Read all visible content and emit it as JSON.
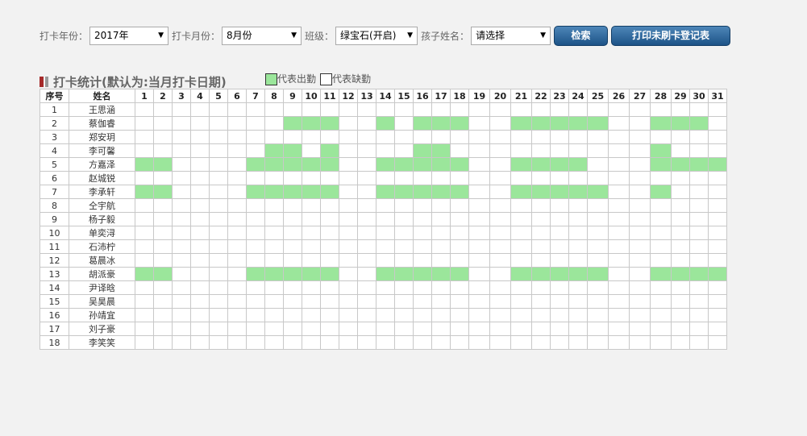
{
  "filters": {
    "year_label": "打卡年份：",
    "year_value": "2017年",
    "month_label": "打卡月份：",
    "month_value": "8月份",
    "class_label": "班级：",
    "class_value": "绿宝石(开启)",
    "child_label": "孩子姓名：",
    "child_value": "请选择",
    "search_button": "检索",
    "print_button": "打印未刷卡登记表"
  },
  "section": {
    "title": "打卡统计(默认为:当月打卡日期)"
  },
  "legend": {
    "present_label": "代表出勤",
    "absent_label": "代表缺勤",
    "present_color": "#9be69b",
    "absent_color": "#ffffff"
  },
  "table": {
    "index_header": "序号",
    "name_header": "姓名",
    "days": [
      "1",
      "2",
      "3",
      "4",
      "5",
      "6",
      "7",
      "8",
      "9",
      "10",
      "11",
      "12",
      "13",
      "14",
      "15",
      "16",
      "17",
      "18",
      "19",
      "20",
      "21",
      "22",
      "23",
      "24",
      "25",
      "26",
      "27",
      "28",
      "29",
      "30",
      "31"
    ],
    "rows": [
      {
        "index": "1",
        "name": "王思涵",
        "present": []
      },
      {
        "index": "2",
        "name": "蔡伽睿",
        "present": [
          9,
          10,
          11,
          14,
          16,
          17,
          18,
          21,
          22,
          23,
          24,
          25,
          28,
          29,
          30
        ]
      },
      {
        "index": "3",
        "name": "郑安玥",
        "present": []
      },
      {
        "index": "4",
        "name": "李可馨",
        "present": [
          8,
          9,
          11,
          16,
          17,
          28
        ]
      },
      {
        "index": "5",
        "name": "方嘉泽",
        "present": [
          1,
          2,
          7,
          8,
          9,
          10,
          11,
          14,
          15,
          16,
          17,
          18,
          21,
          22,
          23,
          24,
          28,
          29,
          30,
          31
        ]
      },
      {
        "index": "6",
        "name": "赵城锐",
        "present": []
      },
      {
        "index": "7",
        "name": "李承轩",
        "present": [
          1,
          2,
          7,
          8,
          9,
          10,
          11,
          14,
          15,
          16,
          17,
          18,
          21,
          22,
          23,
          24,
          25,
          28
        ]
      },
      {
        "index": "8",
        "name": "仝宇航",
        "present": []
      },
      {
        "index": "9",
        "name": "杨子毅",
        "present": []
      },
      {
        "index": "10",
        "name": "单奕浔",
        "present": []
      },
      {
        "index": "11",
        "name": "石沛柠",
        "present": []
      },
      {
        "index": "12",
        "name": "葛晨冰",
        "present": []
      },
      {
        "index": "13",
        "name": "胡派豪",
        "present": [
          1,
          2,
          7,
          8,
          9,
          10,
          11,
          14,
          15,
          16,
          17,
          18,
          21,
          22,
          23,
          24,
          25,
          28,
          29,
          30,
          31
        ]
      },
      {
        "index": "14",
        "name": "尹译晗",
        "present": []
      },
      {
        "index": "15",
        "name": "吴昊晨",
        "present": []
      },
      {
        "index": "16",
        "name": "孙靖宜",
        "present": []
      },
      {
        "index": "17",
        "name": "刘子豪",
        "present": []
      },
      {
        "index": "18",
        "name": "李笑笑",
        "present": []
      }
    ]
  }
}
